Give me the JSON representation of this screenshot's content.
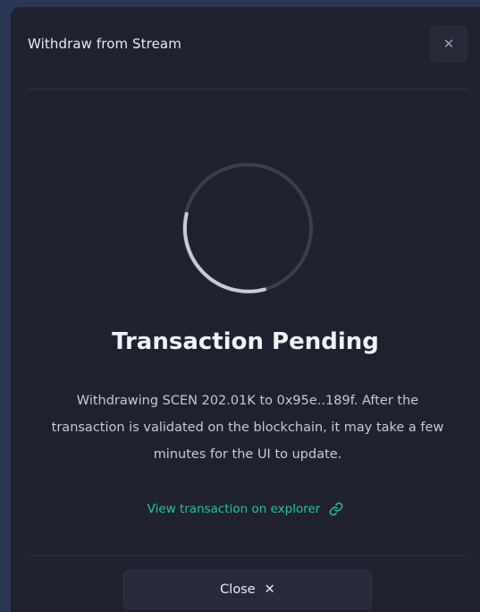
{
  "modal": {
    "title": "Withdraw from Stream",
    "close_icon": "✕"
  },
  "status": {
    "spinner_icon": "loading-spinner",
    "heading": "Transaction Pending",
    "message": "Withdrawing SCEN 202.01K to 0x95e..189f. After the transaction is validated on the blockchain, it may take a few minutes for the UI to update."
  },
  "explorer": {
    "label": "View transaction on explorer",
    "icon": "link-icon",
    "color": "#22c79a"
  },
  "footer": {
    "close_label": "Close",
    "close_icon": "✕"
  }
}
